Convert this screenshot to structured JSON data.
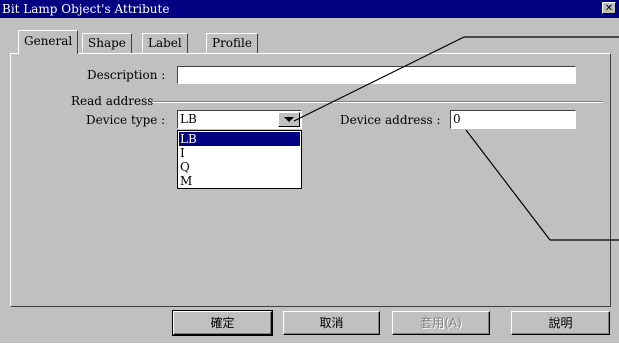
{
  "window": {
    "title": "Bit Lamp Object's Attribute",
    "close_glyph": "✕"
  },
  "tabs": [
    {
      "label": "General",
      "active": true
    },
    {
      "label": "Shape",
      "active": false
    },
    {
      "label": "Label",
      "active": false
    },
    {
      "label": "Profile",
      "active": false
    }
  ],
  "general": {
    "description_label": "Description :",
    "description_value": "",
    "read_address_label": "Read address",
    "device_type_label": "Device type :",
    "device_type_value": "LB",
    "device_type_options": [
      "LB",
      "I",
      "Q",
      "M"
    ],
    "device_address_label": "Device address :",
    "device_address_value": "0"
  },
  "buttons": {
    "ok": "確定",
    "cancel": "取消",
    "apply": "套用(A)",
    "help": "說明"
  },
  "icons": {
    "dropdown": "chevron-down-icon",
    "close": "close-icon"
  }
}
